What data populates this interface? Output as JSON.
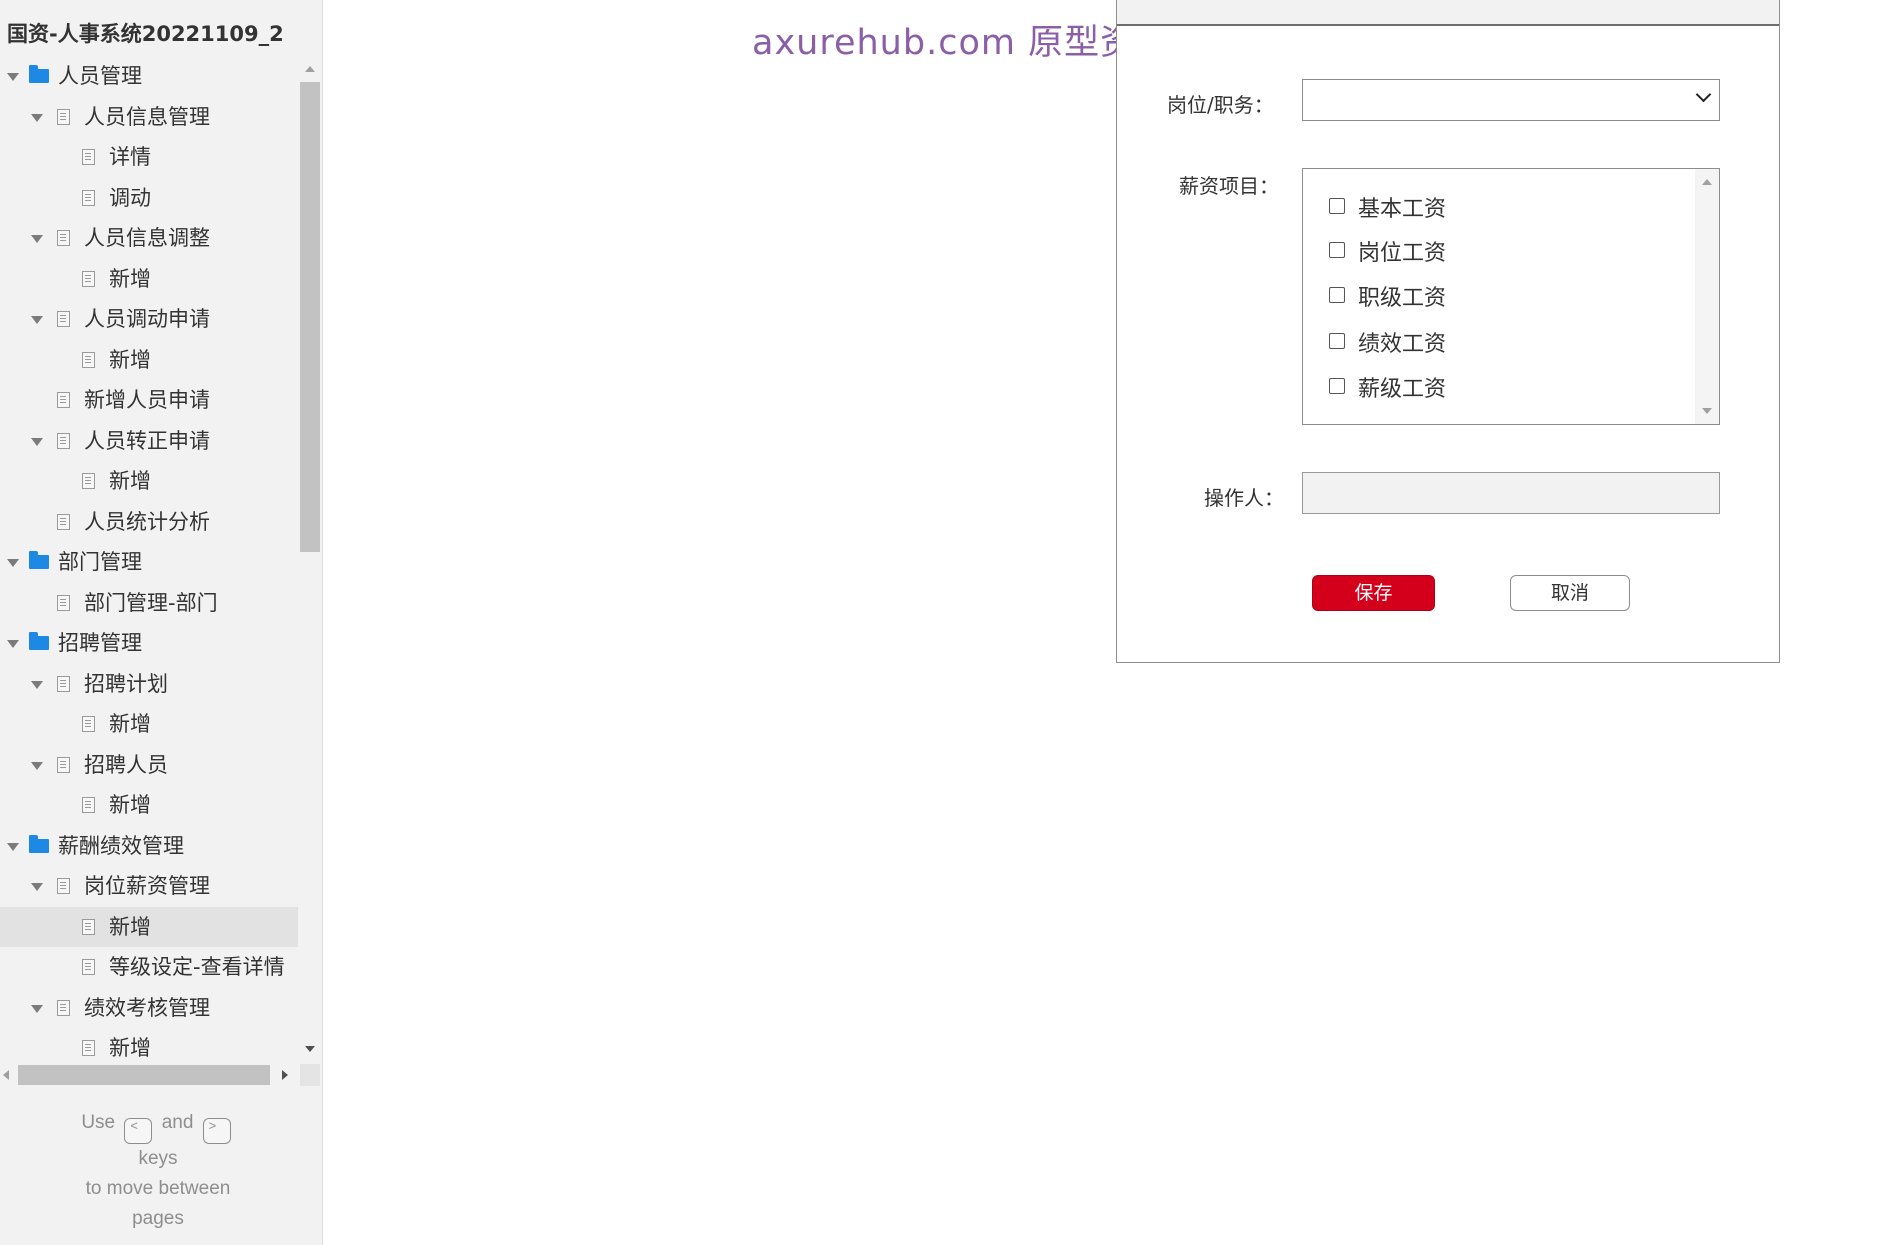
{
  "project_title": "国资-人事系统20221109_2",
  "watermark": "axurehub.com 原型资源站",
  "sidebar": {
    "items": [
      {
        "label": "人员管理",
        "level": 0,
        "kind": "folder",
        "expanded": true
      },
      {
        "label": "人员信息管理",
        "level": 1,
        "kind": "page",
        "expanded": true
      },
      {
        "label": "详情",
        "level": 2,
        "kind": "page"
      },
      {
        "label": "调动",
        "level": 2,
        "kind": "page"
      },
      {
        "label": "人员信息调整",
        "level": 1,
        "kind": "page",
        "expanded": true
      },
      {
        "label": "新增",
        "level": 2,
        "kind": "page"
      },
      {
        "label": "人员调动申请",
        "level": 1,
        "kind": "page",
        "expanded": true
      },
      {
        "label": "新增",
        "level": 2,
        "kind": "page"
      },
      {
        "label": "新增人员申请",
        "level": 1,
        "kind": "page"
      },
      {
        "label": "人员转正申请",
        "level": 1,
        "kind": "page",
        "expanded": true
      },
      {
        "label": "新增",
        "level": 2,
        "kind": "page"
      },
      {
        "label": "人员统计分析",
        "level": 1,
        "kind": "page"
      },
      {
        "label": "部门管理",
        "level": 0,
        "kind": "folder",
        "expanded": true
      },
      {
        "label": "部门管理-部门",
        "level": 1,
        "kind": "page"
      },
      {
        "label": "招聘管理",
        "level": 0,
        "kind": "folder",
        "expanded": true
      },
      {
        "label": "招聘计划",
        "level": 1,
        "kind": "page",
        "expanded": true
      },
      {
        "label": "新增",
        "level": 2,
        "kind": "page"
      },
      {
        "label": "招聘人员",
        "level": 1,
        "kind": "page",
        "expanded": true
      },
      {
        "label": "新增",
        "level": 2,
        "kind": "page"
      },
      {
        "label": "薪酬绩效管理",
        "level": 0,
        "kind": "folder",
        "expanded": true
      },
      {
        "label": "岗位薪资管理",
        "level": 1,
        "kind": "page",
        "expanded": true
      },
      {
        "label": "新增",
        "level": 2,
        "kind": "page",
        "selected": true
      },
      {
        "label": "等级设定-查看详情",
        "level": 2,
        "kind": "page"
      },
      {
        "label": "绩效考核管理",
        "level": 1,
        "kind": "page",
        "expanded": true
      },
      {
        "label": "新增",
        "level": 2,
        "kind": "page"
      }
    ]
  },
  "nav_hint": {
    "use": "Use",
    "prev_key": "<",
    "and": "and",
    "next_key": ">",
    "keys": "keys",
    "line2": "to move between",
    "line3": "pages"
  },
  "dialog": {
    "position_label": "岗位/职务：",
    "position_value": "",
    "salary_items_label": "薪资项目：",
    "salary_items": [
      {
        "label": "基本工资",
        "checked": false
      },
      {
        "label": "岗位工资",
        "checked": false
      },
      {
        "label": "职级工资",
        "checked": false
      },
      {
        "label": "绩效工资",
        "checked": false
      },
      {
        "label": "薪级工资",
        "checked": false
      }
    ],
    "operator_label": "操作人：",
    "operator_value": "",
    "save_label": "保存",
    "cancel_label": "取消"
  },
  "colors": {
    "save_button": "#d4001b",
    "folder_icon": "#1e88e5",
    "watermark": "#8b5ea8"
  }
}
